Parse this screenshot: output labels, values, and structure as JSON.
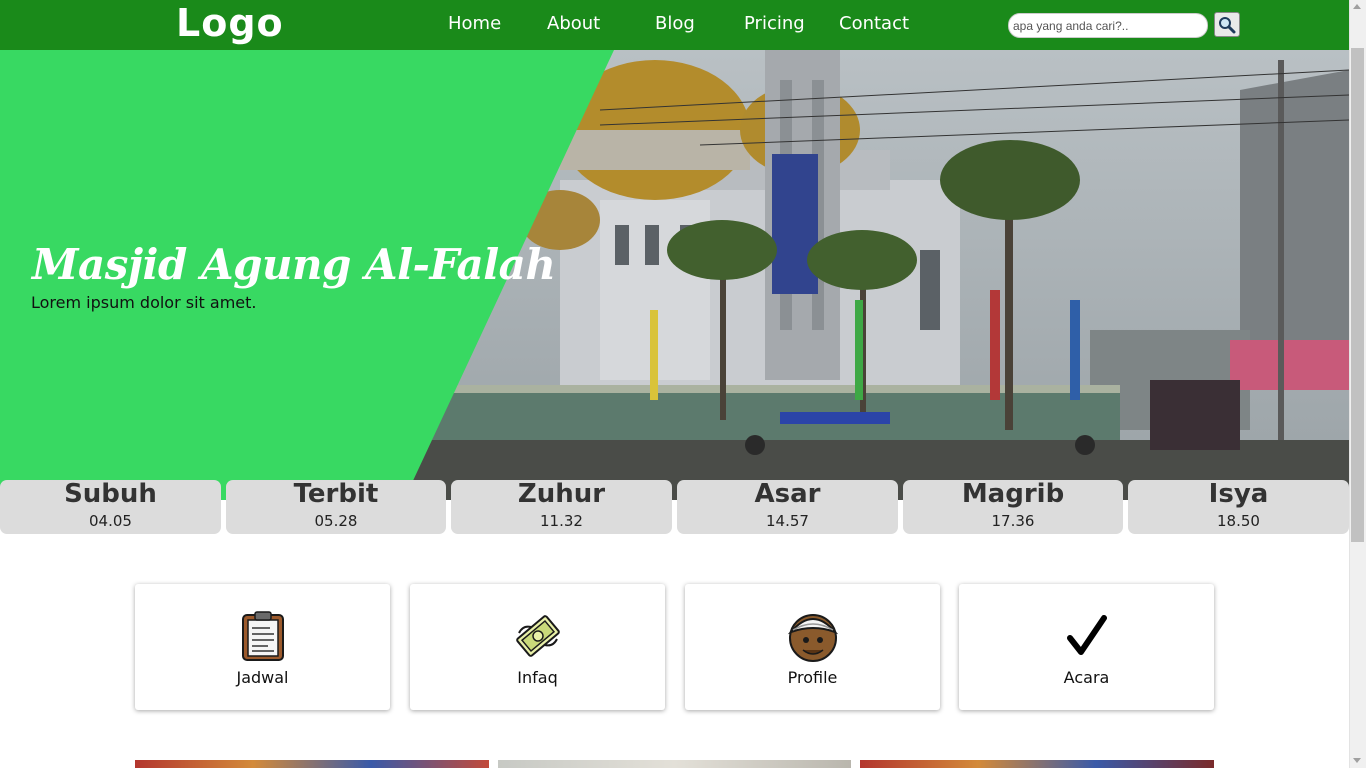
{
  "header": {
    "logo": "Logo",
    "nav": [
      "Home",
      "About",
      "Blog",
      "Pricing",
      "Contact"
    ],
    "search_placeholder": "apa yang anda cari?.."
  },
  "hero": {
    "title": "Masjid Agung Al-Falah",
    "subtitle": "Lorem ipsum dolor sit amet."
  },
  "prayers": [
    {
      "name": "Subuh",
      "time": "04.05"
    },
    {
      "name": "Terbit",
      "time": "05.28"
    },
    {
      "name": "Zuhur",
      "time": "11.32"
    },
    {
      "name": "Asar",
      "time": "14.57"
    },
    {
      "name": "Magrib",
      "time": "17.36"
    },
    {
      "name": "Isya",
      "time": "18.50"
    }
  ],
  "features": [
    {
      "label": "Jadwal",
      "icon": "clipboard-icon"
    },
    {
      "label": "Infaq",
      "icon": "money-icon"
    },
    {
      "label": "Profile",
      "icon": "person-turban-icon"
    },
    {
      "label": "Acara",
      "icon": "checkmark-icon"
    }
  ],
  "colors": {
    "header": "#1a8a1a",
    "hero_green": "#38d962",
    "prayer_card": "#dcdcdc"
  }
}
